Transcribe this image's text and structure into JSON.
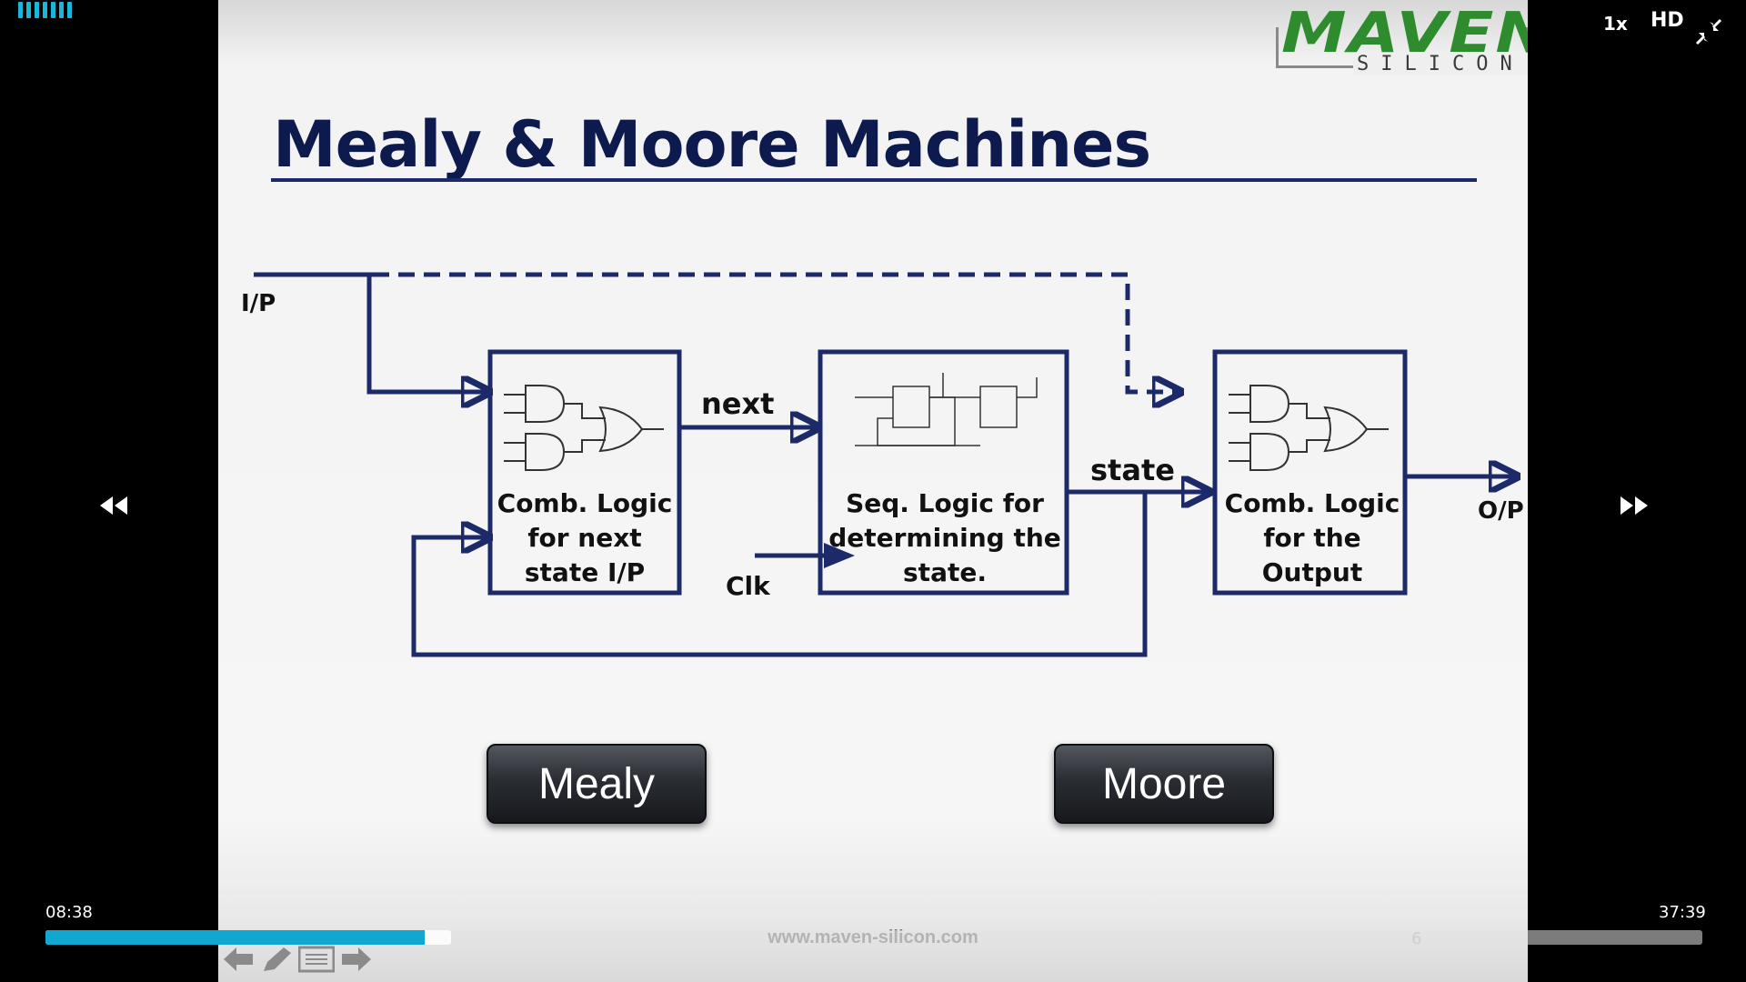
{
  "player": {
    "speed_label": "1x",
    "quality_label": "HD",
    "current_time": "08:38",
    "duration": "37:39",
    "progress_fraction": 0.229,
    "buffered_fraction": 0.245,
    "accent_color": "#12a7d1",
    "icons": [
      "signal-bars-icon",
      "rewind-icon",
      "fast-forward-icon",
      "collapse-icon"
    ]
  },
  "slide": {
    "logo_text": "MAVEN",
    "logo_subtext": "SILICON",
    "title": "Mealy & Moore Machines",
    "title_color": "#0d1a4d",
    "diagram": {
      "input_label": "I/P",
      "next_label": "next",
      "state_label": "state",
      "clk_label": "Clk",
      "output_label": "O/P",
      "block1_lines": [
        "Comb. Logic",
        "for next",
        "state I/P"
      ],
      "block2_lines": [
        "Seq. Logic for",
        "determining the",
        "state."
      ],
      "block3_lines": [
        "Comb. Logic",
        "for the",
        "Output"
      ]
    },
    "buttons": {
      "mealy": "Mealy",
      "moore": "Moore"
    },
    "footer_url": "www.maven-silicon.com",
    "page_number": "6",
    "nav_icons": [
      "prev-arrow-icon",
      "pen-icon",
      "menu-icon",
      "next-arrow-icon"
    ]
  }
}
